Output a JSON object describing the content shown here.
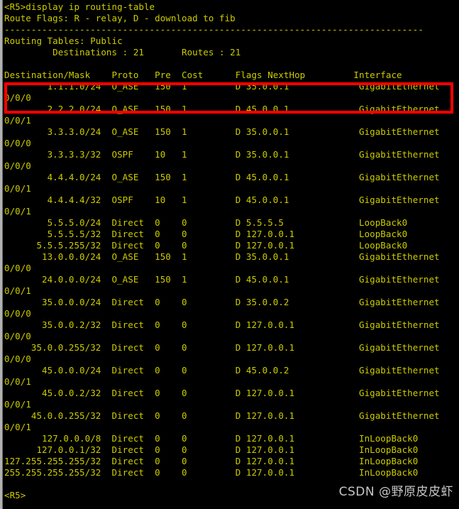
{
  "terminal": {
    "prompt": "<R5>",
    "command": "display ip routing-table",
    "command_line": "<R5>display ip routing-table",
    "route_flags_line": "Route Flags: R - relay, D - download to fib",
    "separator_line": "------------------------------------------------------------------------------",
    "routing_tables_line": "Routing Tables: Public",
    "summary_line": "         Destinations : 21       Routes : 21",
    "destinations_count": "21",
    "routes_count": "21",
    "blank_line": "",
    "trailing_prompt": "<R5>"
  },
  "table": {
    "headers": [
      "Destination/Mask",
      "Proto",
      "Pre",
      "Cost",
      "Flags",
      "NextHop",
      "Interface"
    ],
    "header_line": "Destination/Mask    Proto   Pre  Cost      Flags NextHop         Interface",
    "rows": [
      {
        "destination": "1.1.1.0/24",
        "proto": "O_ASE",
        "pre": "150",
        "cost": "1",
        "flags": "D",
        "nexthop": "35.0.0.1",
        "interface": "GigabitEthernet0/0/0",
        "highlighted": true
      },
      {
        "destination": "2.2.2.0/24",
        "proto": "O_ASE",
        "pre": "150",
        "cost": "1",
        "flags": "D",
        "nexthop": "45.0.0.1",
        "interface": "GigabitEthernet0/0/1",
        "highlighted": false
      },
      {
        "destination": "3.3.3.0/24",
        "proto": "O_ASE",
        "pre": "150",
        "cost": "1",
        "flags": "D",
        "nexthop": "35.0.0.1",
        "interface": "GigabitEthernet0/0/0",
        "highlighted": false
      },
      {
        "destination": "3.3.3.3/32",
        "proto": "OSPF",
        "pre": "10",
        "cost": "1",
        "flags": "D",
        "nexthop": "35.0.0.1",
        "interface": "GigabitEthernet0/0/0",
        "highlighted": false
      },
      {
        "destination": "4.4.4.0/24",
        "proto": "O_ASE",
        "pre": "150",
        "cost": "1",
        "flags": "D",
        "nexthop": "45.0.0.1",
        "interface": "GigabitEthernet0/0/1",
        "highlighted": false
      },
      {
        "destination": "4.4.4.4/32",
        "proto": "OSPF",
        "pre": "10",
        "cost": "1",
        "flags": "D",
        "nexthop": "45.0.0.1",
        "interface": "GigabitEthernet0/0/1",
        "highlighted": false
      },
      {
        "destination": "5.5.5.0/24",
        "proto": "Direct",
        "pre": "0",
        "cost": "0",
        "flags": "D",
        "nexthop": "5.5.5.5",
        "interface": "LoopBack0",
        "highlighted": false
      },
      {
        "destination": "5.5.5.5/32",
        "proto": "Direct",
        "pre": "0",
        "cost": "0",
        "flags": "D",
        "nexthop": "127.0.0.1",
        "interface": "LoopBack0",
        "highlighted": false
      },
      {
        "destination": "5.5.5.255/32",
        "proto": "Direct",
        "pre": "0",
        "cost": "0",
        "flags": "D",
        "nexthop": "127.0.0.1",
        "interface": "LoopBack0",
        "highlighted": false
      },
      {
        "destination": "13.0.0.0/24",
        "proto": "O_ASE",
        "pre": "150",
        "cost": "1",
        "flags": "D",
        "nexthop": "35.0.0.1",
        "interface": "GigabitEthernet0/0/0",
        "highlighted": false
      },
      {
        "destination": "24.0.0.0/24",
        "proto": "O_ASE",
        "pre": "150",
        "cost": "1",
        "flags": "D",
        "nexthop": "45.0.0.1",
        "interface": "GigabitEthernet0/0/1",
        "highlighted": false
      },
      {
        "destination": "35.0.0.0/24",
        "proto": "Direct",
        "pre": "0",
        "cost": "0",
        "flags": "D",
        "nexthop": "35.0.0.2",
        "interface": "GigabitEthernet0/0/0",
        "highlighted": false
      },
      {
        "destination": "35.0.0.2/32",
        "proto": "Direct",
        "pre": "0",
        "cost": "0",
        "flags": "D",
        "nexthop": "127.0.0.1",
        "interface": "GigabitEthernet0/0/0",
        "highlighted": false
      },
      {
        "destination": "35.0.0.255/32",
        "proto": "Direct",
        "pre": "0",
        "cost": "0",
        "flags": "D",
        "nexthop": "127.0.0.1",
        "interface": "GigabitEthernet0/0/0",
        "highlighted": false
      },
      {
        "destination": "45.0.0.0/24",
        "proto": "Direct",
        "pre": "0",
        "cost": "0",
        "flags": "D",
        "nexthop": "45.0.0.2",
        "interface": "GigabitEthernet0/0/1",
        "highlighted": false
      },
      {
        "destination": "45.0.0.2/32",
        "proto": "Direct",
        "pre": "0",
        "cost": "0",
        "flags": "D",
        "nexthop": "127.0.0.1",
        "interface": "GigabitEthernet0/0/1",
        "highlighted": false
      },
      {
        "destination": "45.0.0.255/32",
        "proto": "Direct",
        "pre": "0",
        "cost": "0",
        "flags": "D",
        "nexthop": "127.0.0.1",
        "interface": "GigabitEthernet0/0/1",
        "highlighted": false
      },
      {
        "destination": "127.0.0.0/8",
        "proto": "Direct",
        "pre": "0",
        "cost": "0",
        "flags": "D",
        "nexthop": "127.0.0.1",
        "interface": "InLoopBack0",
        "highlighted": false
      },
      {
        "destination": "127.0.0.1/32",
        "proto": "Direct",
        "pre": "0",
        "cost": "0",
        "flags": "D",
        "nexthop": "127.0.0.1",
        "interface": "InLoopBack0",
        "highlighted": false
      },
      {
        "destination": "127.255.255.255/32",
        "proto": "Direct",
        "pre": "0",
        "cost": "0",
        "flags": "D",
        "nexthop": "127.0.0.1",
        "interface": "InLoopBack0",
        "highlighted": false
      },
      {
        "destination": "255.255.255.255/32",
        "proto": "Direct",
        "pre": "0",
        "cost": "0",
        "flags": "D",
        "nexthop": "127.0.0.1",
        "interface": "InLoopBack0",
        "highlighted": false
      }
    ]
  },
  "watermark": {
    "text": "CSDN @野原皮皮虾"
  },
  "colors": {
    "background": "#000000",
    "text": "#cccc00",
    "highlight_border": "#ff0000",
    "watermark": "#d8d8d8",
    "scrollbar": "#b4b4b4"
  }
}
